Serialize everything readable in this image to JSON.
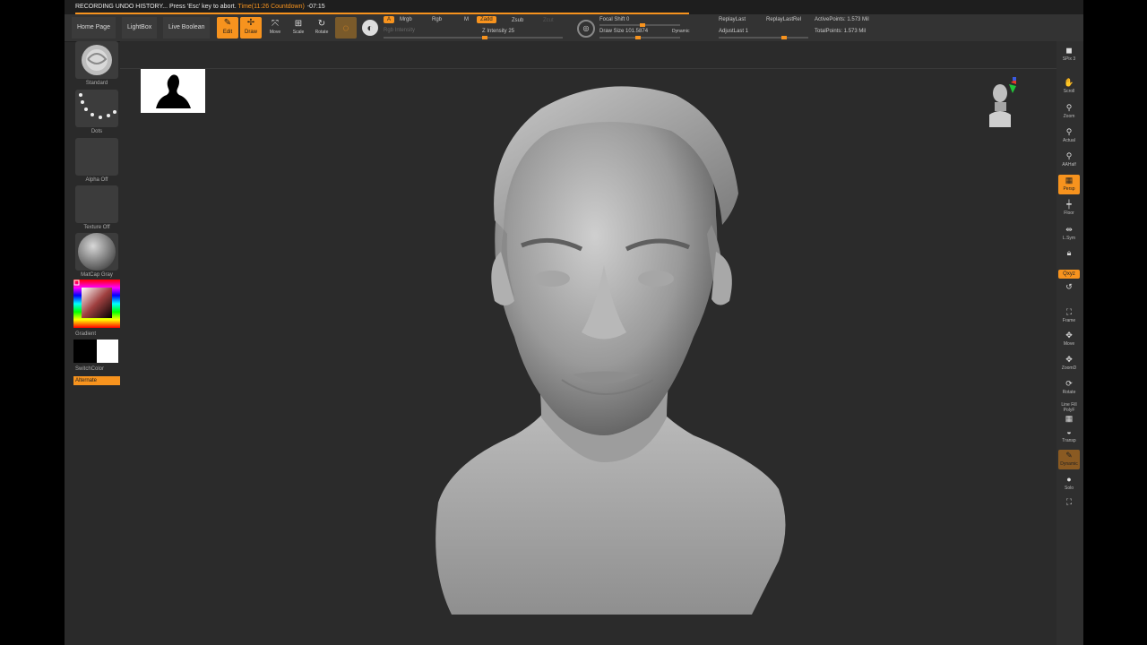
{
  "status": {
    "message": "RECORDING UNDO HISTORY... Press 'Esc' key to abort.",
    "time": "Time(11:26",
    "countdown": "Countdown)",
    "remaining": "-07:15"
  },
  "toolbar": {
    "tabs": [
      "Home Page",
      "LightBox",
      "Live Boolean"
    ],
    "modes": {
      "edit": "Edit",
      "draw": "Draw",
      "move": "Move",
      "scale": "Scale",
      "rotate": "Rotate"
    },
    "channel": {
      "a": "A",
      "mrgb": "Mrgb",
      "rgb": "Rgb",
      "m": "M",
      "zadd": "Zadd",
      "zsub": "Zsub",
      "zcut": "Zcut"
    },
    "rgb_intensity": "Rgb Intensity",
    "z_intensity": "Z Intensity 25",
    "focal_shift": "Focal Shift 0",
    "draw_size": "Draw Size 101.5874",
    "dynamic": "Dynamic",
    "replay_last": "ReplayLast",
    "replay_last_rel": "ReplayLastRel",
    "adjust_last": "AdjustLast 1",
    "active_points": "ActivePoints: 1.573 Mil",
    "total_points": "TotalPoints: 1.573 Mil"
  },
  "left_shelf": {
    "brush": "Standard",
    "stroke": "Dots",
    "alpha": "Alpha Off",
    "texture": "Texture Off",
    "material": "MatCap Gray",
    "gradient": "Gradient",
    "switch_color": "SwitchColor",
    "alternate": "Alternate"
  },
  "right_shelf": [
    "SPix 3",
    "Scroll",
    "Zoom",
    "Actual",
    "AAHalf",
    "Persp",
    "Floor",
    "L.Sym",
    "Qxyz",
    "Frame",
    "Move",
    "ZoomD",
    "Rotate",
    "Line Fill PolyF",
    "Transp",
    "Dynamic",
    "Solo",
    "Xpose"
  ],
  "colors": {
    "accent": "#f7931e",
    "background": "#2b2b2b",
    "panel": "#333333"
  }
}
